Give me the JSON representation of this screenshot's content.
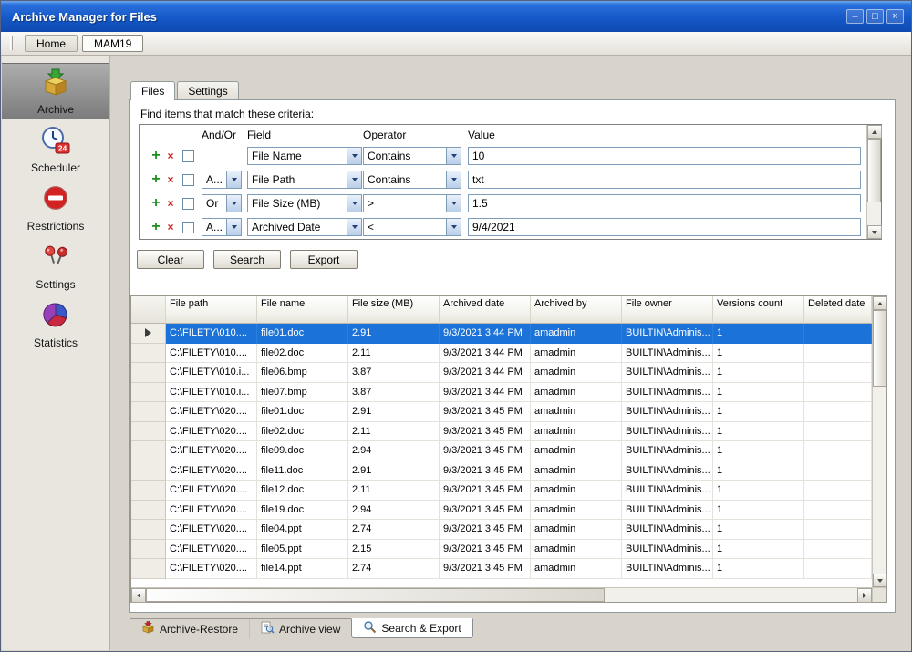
{
  "window": {
    "title": "Archive Manager for Files",
    "controls": {
      "minimize": "–",
      "maximize": "□",
      "close": "×"
    }
  },
  "navbar": {
    "items": [
      {
        "label": "Home",
        "active": false
      },
      {
        "label": "MAM19",
        "active": true
      }
    ]
  },
  "sidebar": {
    "items": [
      {
        "label": "Archive",
        "icon": "archive-box-icon",
        "selected": true
      },
      {
        "label": "Scheduler",
        "icon": "clock-24-icon",
        "selected": false
      },
      {
        "label": "Restrictions",
        "icon": "no-entry-icon",
        "selected": false
      },
      {
        "label": "Settings",
        "icon": "pushpin-icon",
        "selected": false
      },
      {
        "label": "Statistics",
        "icon": "pie-chart-icon",
        "selected": false
      }
    ]
  },
  "main": {
    "tabs": [
      {
        "label": "Files",
        "active": true
      },
      {
        "label": "Settings",
        "active": false
      }
    ],
    "criteria": {
      "title": "Find items that match these criteria:",
      "headers": {
        "andor": "And/Or",
        "field": "Field",
        "operator": "Operator",
        "value": "Value"
      },
      "rows": [
        {
          "andor": "",
          "field": "File Name",
          "operator": "Contains",
          "value": "10"
        },
        {
          "andor": "A...",
          "field": "File Path",
          "operator": "Contains",
          "value": "txt"
        },
        {
          "andor": "Or",
          "field": "File Size (MB)",
          "operator": ">",
          "value": "1.5"
        },
        {
          "andor": "A...",
          "field": "Archived Date",
          "operator": "<",
          "value": "9/4/2021"
        }
      ]
    },
    "actions": {
      "clear": "Clear",
      "search": "Search",
      "export": "Export"
    },
    "grid": {
      "columns": [
        "File path",
        "File name",
        "File size (MB)",
        "Archived date",
        "Archived by",
        "File owner",
        "Versions count",
        "Deleted date"
      ],
      "selected_row": 0,
      "rows": [
        [
          "C:\\FILETY\\010....",
          "file01.doc",
          "2.91",
          "9/3/2021 3:44 PM",
          "amadmin",
          "BUILTIN\\Adminis...",
          "1",
          ""
        ],
        [
          "C:\\FILETY\\010....",
          "file02.doc",
          "2.11",
          "9/3/2021 3:44 PM",
          "amadmin",
          "BUILTIN\\Adminis...",
          "1",
          ""
        ],
        [
          "C:\\FILETY\\010.i...",
          "file06.bmp",
          "3.87",
          "9/3/2021 3:44 PM",
          "amadmin",
          "BUILTIN\\Adminis...",
          "1",
          ""
        ],
        [
          "C:\\FILETY\\010.i...",
          "file07.bmp",
          "3.87",
          "9/3/2021 3:44 PM",
          "amadmin",
          "BUILTIN\\Adminis...",
          "1",
          ""
        ],
        [
          "C:\\FILETY\\020....",
          "file01.doc",
          "2.91",
          "9/3/2021 3:45 PM",
          "amadmin",
          "BUILTIN\\Adminis...",
          "1",
          ""
        ],
        [
          "C:\\FILETY\\020....",
          "file02.doc",
          "2.11",
          "9/3/2021 3:45 PM",
          "amadmin",
          "BUILTIN\\Adminis...",
          "1",
          ""
        ],
        [
          "C:\\FILETY\\020....",
          "file09.doc",
          "2.94",
          "9/3/2021 3:45 PM",
          "amadmin",
          "BUILTIN\\Adminis...",
          "1",
          ""
        ],
        [
          "C:\\FILETY\\020....",
          "file11.doc",
          "2.91",
          "9/3/2021 3:45 PM",
          "amadmin",
          "BUILTIN\\Adminis...",
          "1",
          ""
        ],
        [
          "C:\\FILETY\\020....",
          "file12.doc",
          "2.11",
          "9/3/2021 3:45 PM",
          "amadmin",
          "BUILTIN\\Adminis...",
          "1",
          ""
        ],
        [
          "C:\\FILETY\\020....",
          "file19.doc",
          "2.94",
          "9/3/2021 3:45 PM",
          "amadmin",
          "BUILTIN\\Adminis...",
          "1",
          ""
        ],
        [
          "C:\\FILETY\\020....",
          "file04.ppt",
          "2.74",
          "9/3/2021 3:45 PM",
          "amadmin",
          "BUILTIN\\Adminis...",
          "1",
          ""
        ],
        [
          "C:\\FILETY\\020....",
          "file05.ppt",
          "2.15",
          "9/3/2021 3:45 PM",
          "amadmin",
          "BUILTIN\\Adminis...",
          "1",
          ""
        ],
        [
          "C:\\FILETY\\020....",
          "file14.ppt",
          "2.74",
          "9/3/2021 3:45 PM",
          "amadmin",
          "BUILTIN\\Adminis...",
          "1",
          ""
        ]
      ]
    },
    "bottom_tabs": [
      {
        "label": "Archive-Restore",
        "icon": "archive-restore-icon",
        "active": false
      },
      {
        "label": "Archive view",
        "icon": "archive-view-icon",
        "active": false
      },
      {
        "label": "Search & Export",
        "icon": "search-icon",
        "active": true
      }
    ],
    "colors": {
      "selection": "#1B72D8",
      "titlebar": "#1558C8"
    }
  }
}
